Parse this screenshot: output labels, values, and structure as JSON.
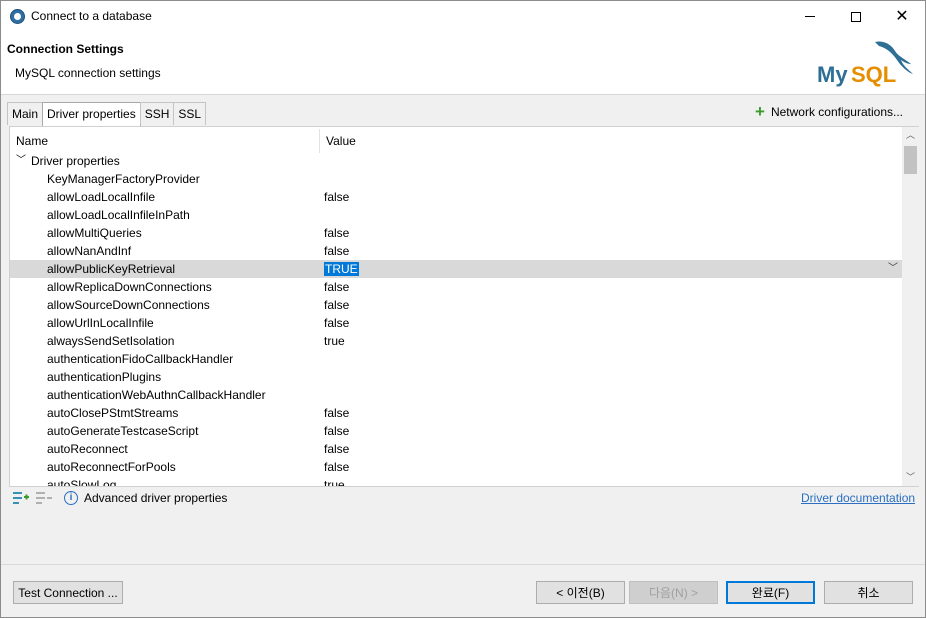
{
  "window": {
    "title": "Connect to a database"
  },
  "header": {
    "title": "Connection Settings",
    "subtitle": "MySQL connection settings",
    "logo_text": "MySQL"
  },
  "tabs": [
    {
      "label": "Main"
    },
    {
      "label": "Driver properties"
    },
    {
      "label": "SSH"
    },
    {
      "label": "SSL"
    }
  ],
  "network_config_label": "Network configurations...",
  "table": {
    "columns": {
      "name": "Name",
      "value": "Value"
    },
    "group_label": "Driver properties",
    "rows": [
      {
        "name": "KeyManagerFactoryProvider",
        "value": ""
      },
      {
        "name": "allowLoadLocalInfile",
        "value": "false"
      },
      {
        "name": "allowLoadLocalInfileInPath",
        "value": ""
      },
      {
        "name": "allowMultiQueries",
        "value": "false"
      },
      {
        "name": "allowNanAndInf",
        "value": "false"
      },
      {
        "name": "allowPublicKeyRetrieval",
        "value": "TRUE"
      },
      {
        "name": "allowReplicaDownConnections",
        "value": "false"
      },
      {
        "name": "allowSourceDownConnections",
        "value": "false"
      },
      {
        "name": "allowUrlInLocalInfile",
        "value": "false"
      },
      {
        "name": "alwaysSendSetIsolation",
        "value": "true"
      },
      {
        "name": "authenticationFidoCallbackHandler",
        "value": ""
      },
      {
        "name": "authenticationPlugins",
        "value": ""
      },
      {
        "name": "authenticationWebAuthnCallbackHandler",
        "value": ""
      },
      {
        "name": "autoClosePStmtStreams",
        "value": "false"
      },
      {
        "name": "autoGenerateTestcaseScript",
        "value": "false"
      },
      {
        "name": "autoReconnect",
        "value": "false"
      },
      {
        "name": "autoReconnectForPools",
        "value": "false"
      },
      {
        "name": "autoSlowLog",
        "value": "true"
      }
    ]
  },
  "footer": {
    "advanced_label": "Advanced driver properties",
    "doc_link": "Driver documentation"
  },
  "buttons": {
    "test": "Test Connection ...",
    "prev": "< 이전(B)",
    "next": "다음(N) >",
    "finish": "완료(F)",
    "cancel": "취소"
  }
}
